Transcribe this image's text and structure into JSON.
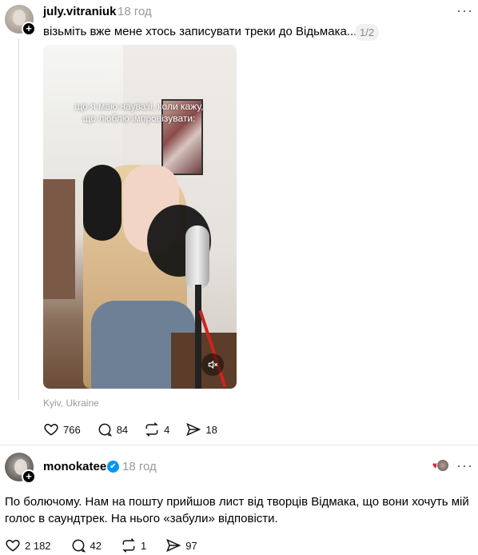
{
  "post1": {
    "username": "july.vitraniuk",
    "time": "18 год",
    "text": "візьміть вже мене хтось записувати треки до Відьмака...",
    "counter": "1/2",
    "video_caption": "що я маю наувазі, коли кажу, що люблю імпровізувати:",
    "location": "Kyiv, Ukraine",
    "actions": {
      "likes": "766",
      "comments": "84",
      "reposts": "4",
      "shares": "18"
    }
  },
  "post2": {
    "username": "monokatee",
    "time": "18 год",
    "text": "По болючому. Нам на пошту прийшов лист від творців Відмака, що вони хочуть мій голос в саундтрек. На нього «забули» відповісти.",
    "actions": {
      "likes": "2 182",
      "comments": "42",
      "reposts": "1",
      "shares": "97"
    }
  },
  "colors": {
    "muted": "#999999",
    "verified": "#0095f6",
    "heart": "#e31b3c"
  }
}
